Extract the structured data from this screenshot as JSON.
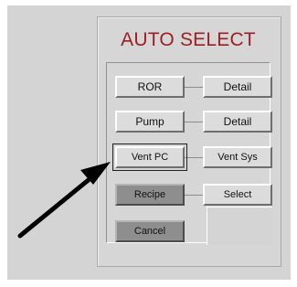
{
  "dialog": {
    "title": "AUTO SELECT"
  },
  "buttons": {
    "ror": "ROR",
    "ror_detail": "Detail",
    "pump": "Pump",
    "pump_detail": "Detail",
    "vent_pc": "Vent PC",
    "vent_sys": "Vent Sys",
    "recipe": "Recipe",
    "recipe_select": "Select",
    "cancel": "Cancel"
  },
  "colors": {
    "title": "#9c1f26",
    "panel": "#d6d6d6",
    "dark_button": "#8e8e8e"
  },
  "annotation": {
    "icon": "pointer-arrow-icon",
    "target": "vent-pc-button"
  }
}
